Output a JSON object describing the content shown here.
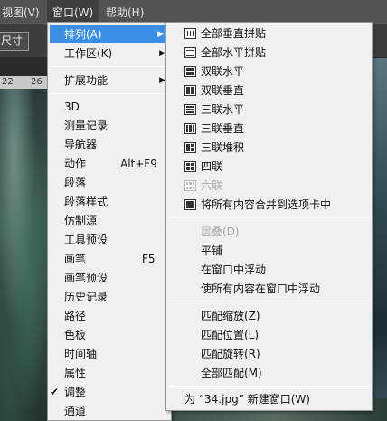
{
  "menubar": {
    "view_label": "视图(V)",
    "window_label": "窗口(W)",
    "help_label": "帮助(H)"
  },
  "options_bar": {
    "size_button_label": "尺寸"
  },
  "ruler": {
    "ticks": [
      "22",
      "26"
    ]
  },
  "window_menu": {
    "items": [
      {
        "label": "排列(A)",
        "has_submenu": true,
        "highlighted": true
      },
      {
        "label": "工作区(K)",
        "has_submenu": true
      },
      {
        "label": "扩展功能",
        "has_submenu": true
      },
      {
        "label": "3D"
      },
      {
        "label": "测量记录"
      },
      {
        "label": "导航器"
      },
      {
        "label": "动作",
        "shortcut": "Alt+F9"
      },
      {
        "label": "段落"
      },
      {
        "label": "段落样式"
      },
      {
        "label": "仿制源"
      },
      {
        "label": "工具预设"
      },
      {
        "label": "画笔",
        "shortcut": "F5"
      },
      {
        "label": "画笔预设"
      },
      {
        "label": "历史记录"
      },
      {
        "label": "路径"
      },
      {
        "label": "色板"
      },
      {
        "label": "时间轴"
      },
      {
        "label": "属性"
      },
      {
        "label": "调整",
        "checked": true,
        "check_mark": "✔"
      },
      {
        "label": "通道"
      }
    ]
  },
  "arrange_submenu": {
    "items": [
      {
        "label": "全部垂直拼贴",
        "icon": "tile-all-vertical-icon"
      },
      {
        "label": "全部水平拼贴",
        "icon": "tile-all-horizontal-icon"
      },
      {
        "label": "双联水平",
        "icon": "two-up-horizontal-icon"
      },
      {
        "label": "双联垂直",
        "icon": "two-up-vertical-icon"
      },
      {
        "label": "三联水平",
        "icon": "three-up-horizontal-icon"
      },
      {
        "label": "三联垂直",
        "icon": "three-up-vertical-icon"
      },
      {
        "label": "三联堆积",
        "icon": "three-up-stacked-icon"
      },
      {
        "label": "四联",
        "icon": "four-up-icon"
      },
      {
        "label": "六联",
        "icon": "six-up-icon",
        "disabled": true
      },
      {
        "label": "将所有内容合并到选项卡中",
        "icon": "consolidate-tabs-icon"
      },
      {
        "label": "层叠(D)",
        "disabled": true
      },
      {
        "label": "平铺"
      },
      {
        "label": "在窗口中浮动"
      },
      {
        "label": "使所有内容在窗口中浮动"
      },
      {
        "label": "匹配缩放(Z)"
      },
      {
        "label": "匹配位置(L)"
      },
      {
        "label": "匹配旋转(R)"
      },
      {
        "label": "全部匹配(M)"
      },
      {
        "label": "为 “34.jpg” 新建窗口(W)"
      }
    ]
  },
  "colors": {
    "highlight": "#3a8ee6",
    "menu_background": "#f0f0f0",
    "disabled_text": "#a8a8a8"
  }
}
